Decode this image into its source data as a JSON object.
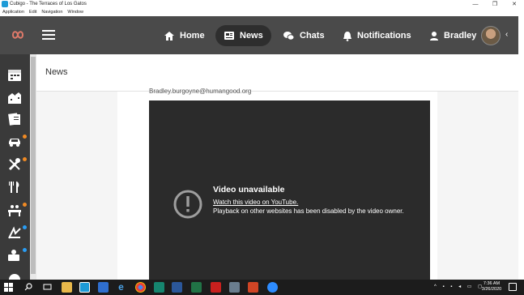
{
  "window": {
    "title": "Cubigo - The Terraces of Los Gatos",
    "menu": [
      "Application",
      "Edit",
      "Navigation",
      "Window"
    ]
  },
  "header": {
    "nav": [
      {
        "label": "Home",
        "icon": "home-icon"
      },
      {
        "label": "News",
        "icon": "news-icon",
        "active": true
      },
      {
        "label": "Chats",
        "icon": "chat-icon"
      },
      {
        "label": "Notifications",
        "icon": "bell-icon"
      },
      {
        "label": "Bradley",
        "icon": "user-icon"
      }
    ]
  },
  "sidebar": {
    "items": [
      {
        "icon": "calendar-icon",
        "badge": null
      },
      {
        "icon": "buildings-icon",
        "badge": null
      },
      {
        "icon": "document-icon",
        "badge": null
      },
      {
        "icon": "car-icon",
        "badge": "#f08a24"
      },
      {
        "icon": "tools-icon",
        "badge": "#f08a24"
      },
      {
        "icon": "dining-icon",
        "badge": null
      },
      {
        "icon": "activity-icon",
        "badge": "#f08a24"
      },
      {
        "icon": "fitness-icon",
        "badge": "#2a9df4"
      },
      {
        "icon": "contacts-icon",
        "badge": "#2a9df4"
      }
    ]
  },
  "page": {
    "title": "News",
    "email": "Bradley.burgoyne@humangood.org"
  },
  "video": {
    "title": "Video unavailable",
    "link": "Watch this video on YouTube.",
    "message": "Playback on other websites has been disabled by the video owner."
  },
  "taskbar": {
    "time": "7:36 AM",
    "date": "3/26/2020"
  },
  "colors": {
    "header_bg": "#4a4a4a",
    "sidebar_bg": "#3a3a3a",
    "video_bg": "#2b2b2b",
    "badge_orange": "#f08a24",
    "badge_blue": "#2a9df4"
  }
}
